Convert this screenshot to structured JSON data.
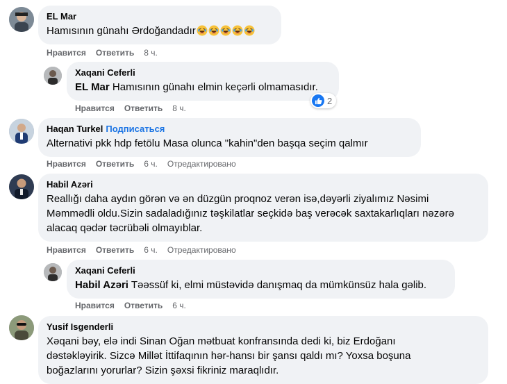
{
  "comments": [
    {
      "author": "EL Mar",
      "text": "Hamısının günahı Ərdoğandadır",
      "emoji_count": 5,
      "actions": {
        "like": "Нравится",
        "reply": "Ответить",
        "time": "8 ч."
      }
    },
    {
      "author": "Xaqani Ceferli",
      "mention": "EL Mar",
      "text": " Hamısının günahı elmin keçərli olmamasıdır.",
      "reaction_count": "2",
      "actions": {
        "like": "Нравится",
        "reply": "Ответить",
        "time": "8 ч."
      }
    },
    {
      "author": "Haqan Turkel",
      "subscribe": "Подписаться",
      "text": "Alternativi pkk hdp fetölu Masa olunca \"kahin\"den başqa seçim qalmır",
      "actions": {
        "like": "Нравится",
        "reply": "Ответить",
        "time": "6 ч.",
        "edited": "Отредактировано"
      }
    },
    {
      "author": "Habil Azəri",
      "lines": [
        "Reallığı daha aydın görən və ən düzgün proqnoz verən isə,dəyərli ziyalımız Nəsimi",
        "Məmmədli oldu.Sizin sadaladığınız təşkilatlar seçkidə baş verəcək saxtakarlıqları nəzərə",
        "alacaq qədər təcrübəli olmayıblar."
      ],
      "actions": {
        "like": "Нравится",
        "reply": "Ответить",
        "time": "6 ч.",
        "edited": "Отредактировано"
      }
    },
    {
      "author": "Xaqani Ceferli",
      "mention": "Habil Azəri",
      "text": " Təəssüf ki, elmi müstəvidə danışmaq da mümkünsüz hala gəlib.",
      "actions": {
        "like": "Нравится",
        "reply": "Ответить",
        "time": "6 ч."
      }
    },
    {
      "author": "Yusif Isgenderli",
      "lines": [
        "Xəqani bəy, elə indi Sinan Oğan mətbuat konfransında dedi ki, biz Erdoğanı",
        "dəstəkləyirik. Sizcə Millət İttifaqının hər-hansı bir şansı qaldı mı? Yoxsa boşuna",
        "boğazlarını yorurlar? Sizin şəxsi fikriniz maraqlıdır."
      ]
    }
  ],
  "colors": {
    "bubble": "#f0f2f5",
    "meta": "#65676b",
    "link": "#1b74e4",
    "like": "#1877f2"
  }
}
